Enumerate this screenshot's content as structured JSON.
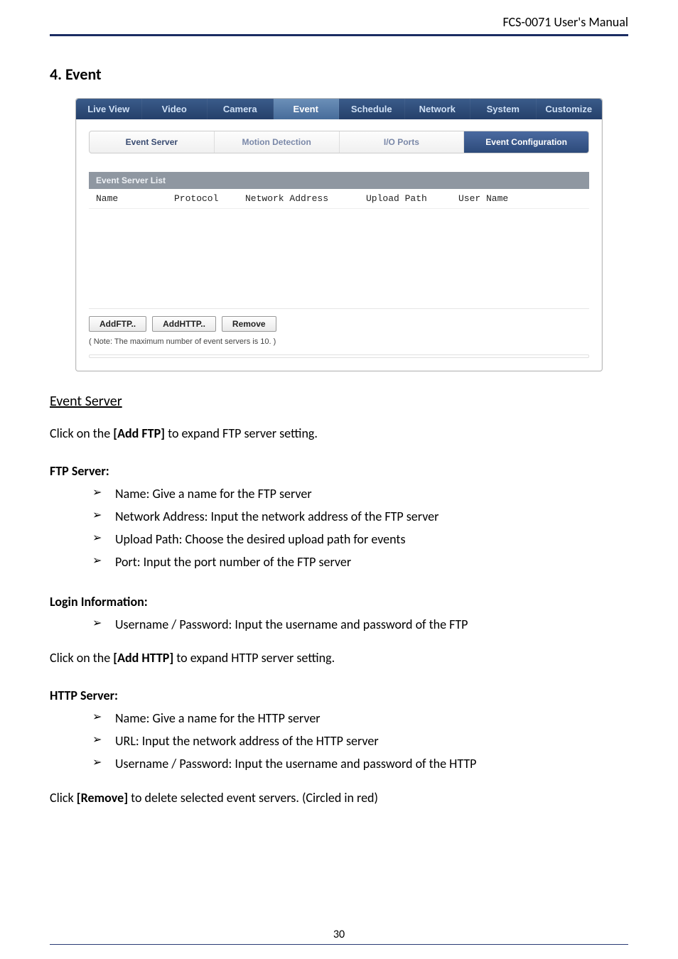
{
  "header": {
    "title": "FCS-0071 User's Manual"
  },
  "section": {
    "heading": "4. Event"
  },
  "ui": {
    "topTabs": {
      "live": "Live View",
      "video": "Video",
      "camera": "Camera",
      "event": "Event",
      "schedule": "Schedule",
      "network": "Network",
      "system": "System",
      "customize": "Customize"
    },
    "subTabs": {
      "eventServer": "Event Server",
      "motionDetection": "Motion Detection",
      "ioPorts": "I/O Ports",
      "eventConfig": "Event Configuration"
    },
    "listTitle": "Event Server List",
    "cols": {
      "name": "Name",
      "protocol": "Protocol",
      "network": "Network Address",
      "upload": "Upload Path",
      "user": "User Name"
    },
    "buttons": {
      "addFtp": "AddFTP..",
      "addHttp": "AddHTTP..",
      "remove": "Remove"
    },
    "note": "( Note: The maximum number of event servers is 10. )"
  },
  "doc": {
    "eventServerHeading": "Event Server",
    "p1_a": "Click on the ",
    "p1_b": "[Add FTP]",
    "p1_c": " to expand FTP server setting.",
    "ftpHeading": "FTP Server:",
    "ftp1": "Name: Give a name for the FTP server",
    "ftp2": "Network Address: Input the network address of the FTP server",
    "ftp3": "Upload Path: Choose the desired upload path for events",
    "ftp4": "Port: Input the port number of the FTP server",
    "loginHeading": "Login Information:",
    "login1": "Username / Password: Input the username and password of the FTP",
    "p2_a": "Click on the ",
    "p2_b": "[Add HTTP]",
    "p2_c": " to expand HTTP server setting.",
    "httpHeading": "HTTP Server:",
    "http1": "Name: Give a name for the HTTP server",
    "http2": "URL: Input the network address of the HTTP server",
    "http3": "Username / Password: Input the username and password of the HTTP",
    "p3_a": "Click ",
    "p3_b": "[Remove]",
    "p3_c": " to delete selected event servers. (Circled in red)"
  },
  "footer": {
    "page": "30"
  }
}
